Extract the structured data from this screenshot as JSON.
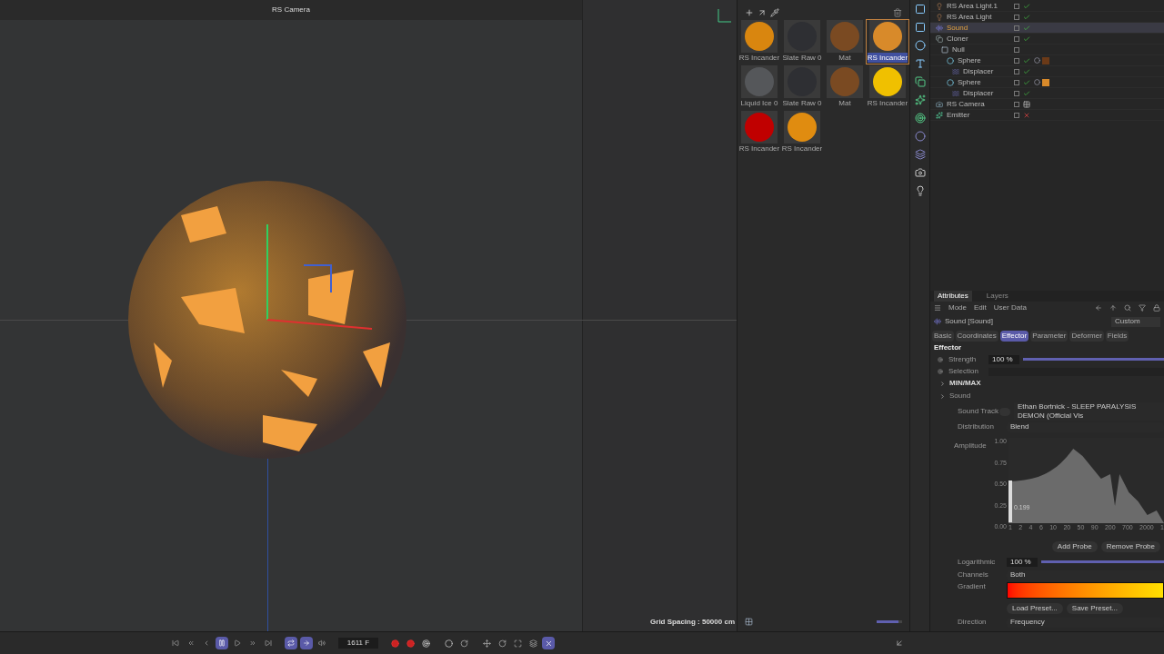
{
  "viewport": {
    "camera": "RS Camera",
    "grid_spacing": "Grid Spacing : 50000 cm"
  },
  "materials": [
    {
      "name": "RS Incander",
      "color": "#d9860f",
      "selected": false
    },
    {
      "name": "Slate Raw 0",
      "color": "#2e2f33",
      "selected": false
    },
    {
      "name": "Mat",
      "color": "#7a4a22",
      "selected": false
    },
    {
      "name": "RS Incander",
      "color": "#d88a2a",
      "selected": true
    },
    {
      "name": "Liquid Ice 0",
      "color": "#55575a",
      "selected": false
    },
    {
      "name": "Slate Raw 0",
      "color": "#2e2f33",
      "selected": false
    },
    {
      "name": "Mat",
      "color": "#7a4a22",
      "selected": false
    },
    {
      "name": "RS Incander",
      "color": "#f0c000",
      "selected": false
    },
    {
      "name": "RS Incander",
      "color": "#c00000",
      "selected": false
    },
    {
      "name": "RS Incander",
      "color": "#e08c10",
      "selected": false
    }
  ],
  "material_zoom": {
    "level": 0.85
  },
  "objects": [
    {
      "name": "RS Area Light.1",
      "kind": "light",
      "enabled": true,
      "selected": false
    },
    {
      "name": "RS Area Light",
      "kind": "light",
      "enabled": true,
      "selected": false
    },
    {
      "name": "Sound",
      "kind": "sound",
      "enabled": true,
      "selected": true
    },
    {
      "name": "Cloner",
      "kind": "cloner",
      "enabled": true,
      "selected": false,
      "children": [
        {
          "name": "Null",
          "kind": "null",
          "selected": false,
          "children": [
            {
              "name": "Sphere",
              "kind": "sphere",
              "enabled": true,
              "selected": false,
              "color": "#6b3a18",
              "children": [
                {
                  "name": "Displacer",
                  "kind": "displacer",
                  "enabled": true,
                  "selected": false
                }
              ]
            },
            {
              "name": "Sphere",
              "kind": "sphere",
              "enabled": true,
              "selected": false,
              "color": "#d88a2a",
              "children": [
                {
                  "name": "Displacer",
                  "kind": "displacer",
                  "enabled": true,
                  "selected": false
                }
              ]
            }
          ]
        }
      ]
    },
    {
      "name": "RS Camera",
      "kind": "camera",
      "enabled": true,
      "selected": false
    },
    {
      "name": "Emitter",
      "kind": "emitter",
      "enabled": false,
      "selected": false
    }
  ],
  "attributes": {
    "tabs": [
      {
        "label": "Attributes",
        "selected": true
      },
      {
        "label": "Layers",
        "selected": false
      }
    ],
    "menu": [
      "Mode",
      "Edit",
      "User Data"
    ],
    "object_title": "Sound [Sound]",
    "preset": "Custom",
    "subtabs": [
      {
        "label": "Basic",
        "selected": false
      },
      {
        "label": "Coordinates",
        "selected": false
      },
      {
        "label": "Effector",
        "selected": true
      },
      {
        "label": "Parameter",
        "selected": false
      },
      {
        "label": "Deformer",
        "selected": false
      },
      {
        "label": "Fields",
        "selected": false
      }
    ],
    "section": "Effector",
    "strength": {
      "label": "Strength",
      "value": "100 %",
      "level": 1
    },
    "selection": {
      "label": "Selection"
    },
    "groups": [
      "MIN/MAX",
      "Sound"
    ],
    "sound_track": {
      "label": "Sound Track",
      "value": "Ethan Bortnick - SLEEP PARALYSIS DEMON (Official Vis"
    },
    "distribution": {
      "label": "Distribution",
      "value": "Blend"
    },
    "amplitude": {
      "label": "Amplitude",
      "yticks": [
        "1.00",
        "0.75",
        "0.50",
        "0.25",
        "0.00"
      ],
      "xticks": [
        "1",
        "2",
        "4",
        "6",
        "10",
        "20",
        "50",
        "90",
        "200",
        "700",
        "2000",
        "1"
      ],
      "probe": "0.199"
    },
    "probe_buttons": [
      "Add Probe",
      "Remove Probe"
    ],
    "logarithmic": {
      "label": "Logarithmic",
      "value": "100 %",
      "level": 1
    },
    "channels": {
      "label": "Channels",
      "value": "Both"
    },
    "gradient": {
      "label": "Gradient"
    },
    "preset_buttons": [
      "Load Preset...",
      "Save Preset..."
    ],
    "direction": {
      "label": "Direction",
      "value": "Frequency"
    }
  },
  "timeline": {
    "frame": "1611 F",
    "playing": true
  }
}
